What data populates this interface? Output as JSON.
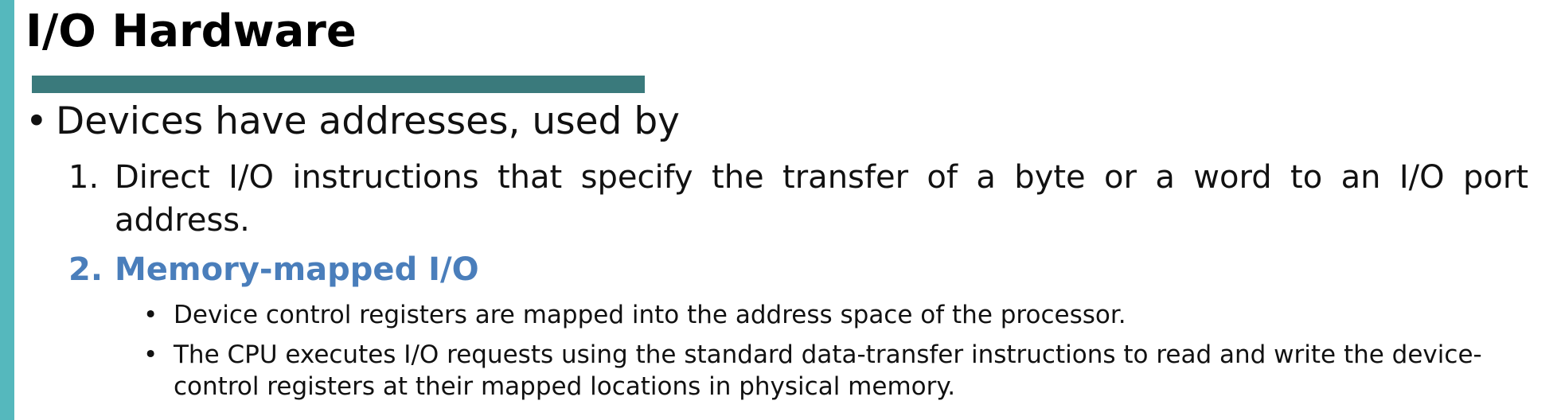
{
  "slide": {
    "title": "I/O Hardware",
    "accent_color": "#55b8bd",
    "rule_color": "#3a7a7c",
    "highlight_color": "#4a7ebb"
  },
  "content": {
    "bullet_glyph": "•",
    "main_bullet": "Devices have addresses, used by",
    "items": [
      {
        "number": "1.",
        "text": "Direct I/O instructions that specify the transfer of a byte or a word to an I/O port address."
      },
      {
        "number": "2.",
        "text": "Memory-mapped I/O"
      }
    ],
    "sub_items": [
      "Device control registers are mapped into the address space of the processor.",
      "The CPU executes I/O requests using the standard data-transfer instructions to read and write the device-control registers at their mapped locations in physical memory."
    ]
  }
}
